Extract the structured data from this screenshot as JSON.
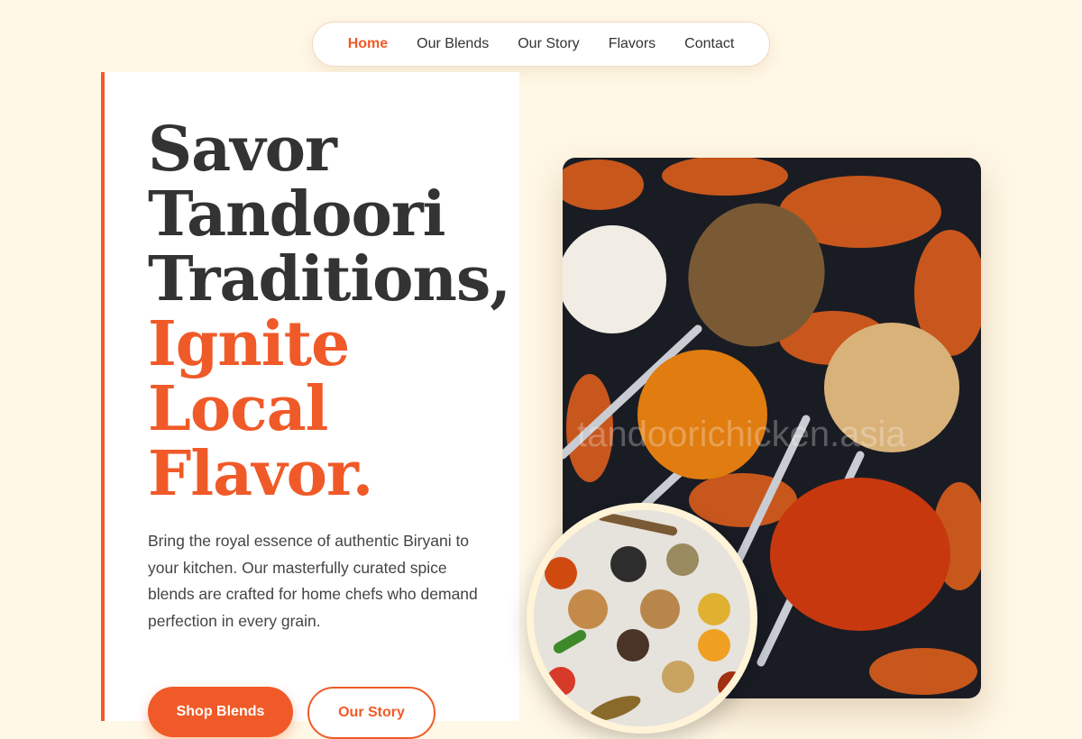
{
  "nav": {
    "items": [
      {
        "label": "Home",
        "active": true
      },
      {
        "label": "Our Blends",
        "active": false
      },
      {
        "label": "Our Story",
        "active": false
      },
      {
        "label": "Flavors",
        "active": false
      },
      {
        "label": "Contact",
        "active": false
      }
    ]
  },
  "hero": {
    "headline_dark": [
      "Savor",
      "Tandoori",
      "Traditions,"
    ],
    "headline_accent": [
      "Ignite",
      "Local",
      "Flavor."
    ],
    "lead": "Bring the royal essence of authentic Biryani to your kitchen. Our masterfully curated spice blends are crafted for home chefs who demand perfection in every grain.",
    "primary_cta": "Shop Blends",
    "secondary_cta": "Our Story"
  },
  "images": {
    "main_watermark": "tandoorichicken.asia",
    "main_icon": "spice-spoons-image",
    "circle_icon": "spice-assortment-image"
  },
  "colors": {
    "accent": "#f05a28",
    "background": "#fff8e6",
    "text": "#333333"
  }
}
